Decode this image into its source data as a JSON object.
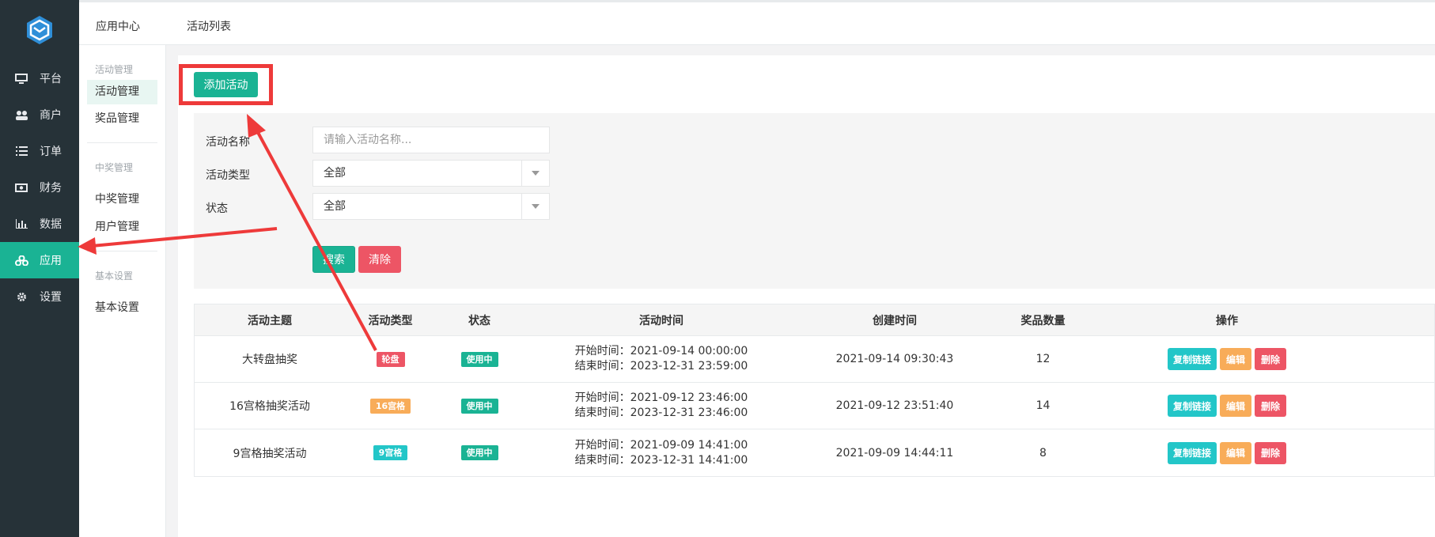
{
  "nav": {
    "items": [
      {
        "label": "平台",
        "icon": "monitor-icon"
      },
      {
        "label": "商户",
        "icon": "users-icon"
      },
      {
        "label": "订单",
        "icon": "list-icon"
      },
      {
        "label": "财务",
        "icon": "money-icon"
      },
      {
        "label": "数据",
        "icon": "bar-chart-icon"
      },
      {
        "label": "应用",
        "icon": "apps-icon",
        "active": true
      },
      {
        "label": "设置",
        "icon": "gear-icon"
      }
    ]
  },
  "breadcrumb": {
    "root": "应用中心",
    "current": "活动列表"
  },
  "subnav": {
    "groups": [
      {
        "title": "活动管理",
        "links": [
          "活动管理",
          "奖品管理"
        ]
      },
      {
        "title": "中奖管理",
        "links": [
          "中奖管理",
          "用户管理"
        ]
      },
      {
        "title": "基本设置",
        "links": [
          "基本设置"
        ]
      }
    ]
  },
  "toolbar": {
    "add_label": "添加活动"
  },
  "filter": {
    "name_label": "活动名称",
    "name_placeholder": "请输入活动名称...",
    "type_label": "活动类型",
    "type_value": "全部",
    "status_label": "状态",
    "status_value": "全部",
    "search_label": "搜索",
    "clear_label": "清除"
  },
  "table": {
    "headers": [
      "活动主题",
      "活动类型",
      "状态",
      "活动时间",
      "创建时间",
      "奖品数量",
      "操作"
    ],
    "start_prefix": "开始时间：",
    "end_prefix": "结束时间：",
    "actions": {
      "copy": "复制链接",
      "edit": "编辑",
      "delete": "删除"
    },
    "rows": [
      {
        "title": "大转盘抽奖",
        "type": "轮盘",
        "type_color": "#ed5565",
        "status": "使用中",
        "start": "2021-09-14 00:00:00",
        "end": "2023-12-31 23:59:00",
        "created": "2021-09-14 09:30:43",
        "prizes": "12"
      },
      {
        "title": "16宫格抽奖活动",
        "type": "16宫格",
        "type_color": "#f8ac59",
        "status": "使用中",
        "start": "2021-09-12 23:46:00",
        "end": "2023-12-31 23:46:00",
        "created": "2021-09-12 23:51:40",
        "prizes": "14"
      },
      {
        "title": "9宫格抽奖活动",
        "type": "9宫格",
        "type_color": "#23c6c8",
        "status": "使用中",
        "start": "2021-09-09 14:41:00",
        "end": "2023-12-31 14:41:00",
        "created": "2021-09-09 14:44:11",
        "prizes": "8"
      }
    ]
  },
  "colors": {
    "primary": "#1ab394",
    "danger": "#ed5565",
    "warning": "#f8ac59",
    "info": "#23c6c8",
    "sidebar": "#263238",
    "annotation": "#ee3a3a"
  }
}
